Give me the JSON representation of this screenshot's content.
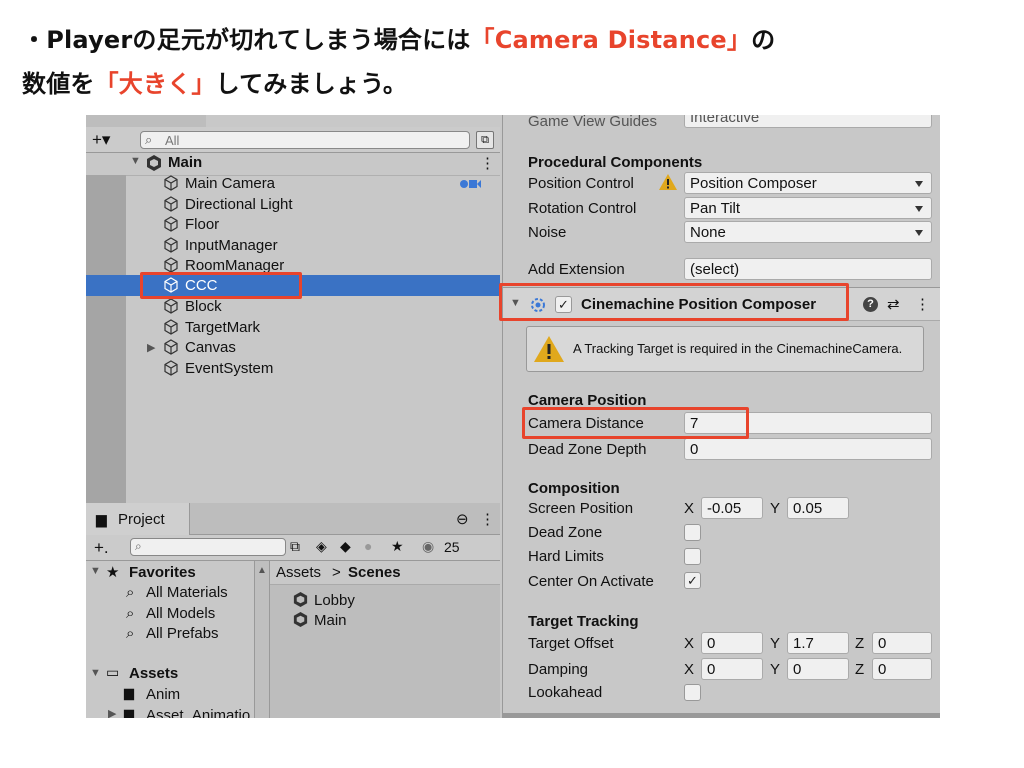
{
  "caption": {
    "line1_pre": "・Playerの足元が切れてしまう場合には",
    "line1_hl": "「Camera Distance」",
    "line1_post": "の",
    "line2_pre": "数値を",
    "line2_hl": "「大きく」",
    "line2_post": "してみましょう。",
    "highlight_color": "#e8442c"
  },
  "hierarchy": {
    "add_button": "+▾",
    "search_placeholder": "All",
    "scene": "Main",
    "scene_menu": "⋮",
    "items": [
      "Main Camera",
      "Directional Light",
      "Floor",
      "InputManager",
      "RoomManager",
      "CCC",
      "Block",
      "TargetMark",
      "Canvas",
      "EventSystem"
    ],
    "selected": "CCC",
    "selection_color": "#3a72c4"
  },
  "project": {
    "tab": "Project",
    "lock": "⊖",
    "menu": "⋮",
    "add_button": "+.",
    "hidden_count": "25",
    "favorites_label": "Favorites",
    "favorites": [
      "All Materials",
      "All Models",
      "All Prefabs"
    ],
    "assets_label": "Assets",
    "asset_folders": [
      "Anim",
      "Asset_Animatio"
    ],
    "breadcrumb_root": "Assets",
    "breadcrumb_sep": ">",
    "breadcrumb_current": "Scenes",
    "scenes": [
      "Lobby",
      "Main"
    ]
  },
  "inspector": {
    "top_cut_label": "Game View Guides",
    "top_cut_value": "Interactive",
    "procedural_title": "Procedural Components",
    "position_control_label": "Position Control",
    "position_control_value": "Position Composer",
    "rotation_control_label": "Rotation Control",
    "rotation_control_value": "Pan Tilt",
    "noise_label": "Noise",
    "noise_value": "None",
    "add_extension_label": "Add Extension",
    "add_extension_value": "(select)",
    "component_title": "Cinemachine Position Composer",
    "component_enabled": "✓",
    "help_icon": "?",
    "preset_icon": "⇄",
    "menu_icon": "⋮",
    "warning": "A Tracking Target is required in the CinemachineCamera.",
    "camera_position_title": "Camera Position",
    "camera_distance_label": "Camera Distance",
    "camera_distance_value": "7",
    "dead_zone_depth_label": "Dead Zone Depth",
    "dead_zone_depth_value": "0",
    "composition_title": "Composition",
    "screen_position_label": "Screen Position",
    "screen_x_label": "X",
    "screen_x": "-0.05",
    "screen_y_label": "Y",
    "screen_y": "0.05",
    "dead_zone_label": "Dead Zone",
    "hard_limits_label": "Hard Limits",
    "center_on_activate_label": "Center On Activate",
    "center_on_activate_check": "✓",
    "target_tracking_title": "Target Tracking",
    "target_offset_label": "Target Offset",
    "target_offset": {
      "x_label": "X",
      "x": "0",
      "y_label": "Y",
      "y": "1.7",
      "z_label": "Z",
      "z": "0"
    },
    "damping_label": "Damping",
    "damping": {
      "x_label": "X",
      "x": "0",
      "y_label": "Y",
      "y": "0",
      "z_label": "Z",
      "z": "0"
    },
    "lookahead_label": "Lookahead"
  }
}
